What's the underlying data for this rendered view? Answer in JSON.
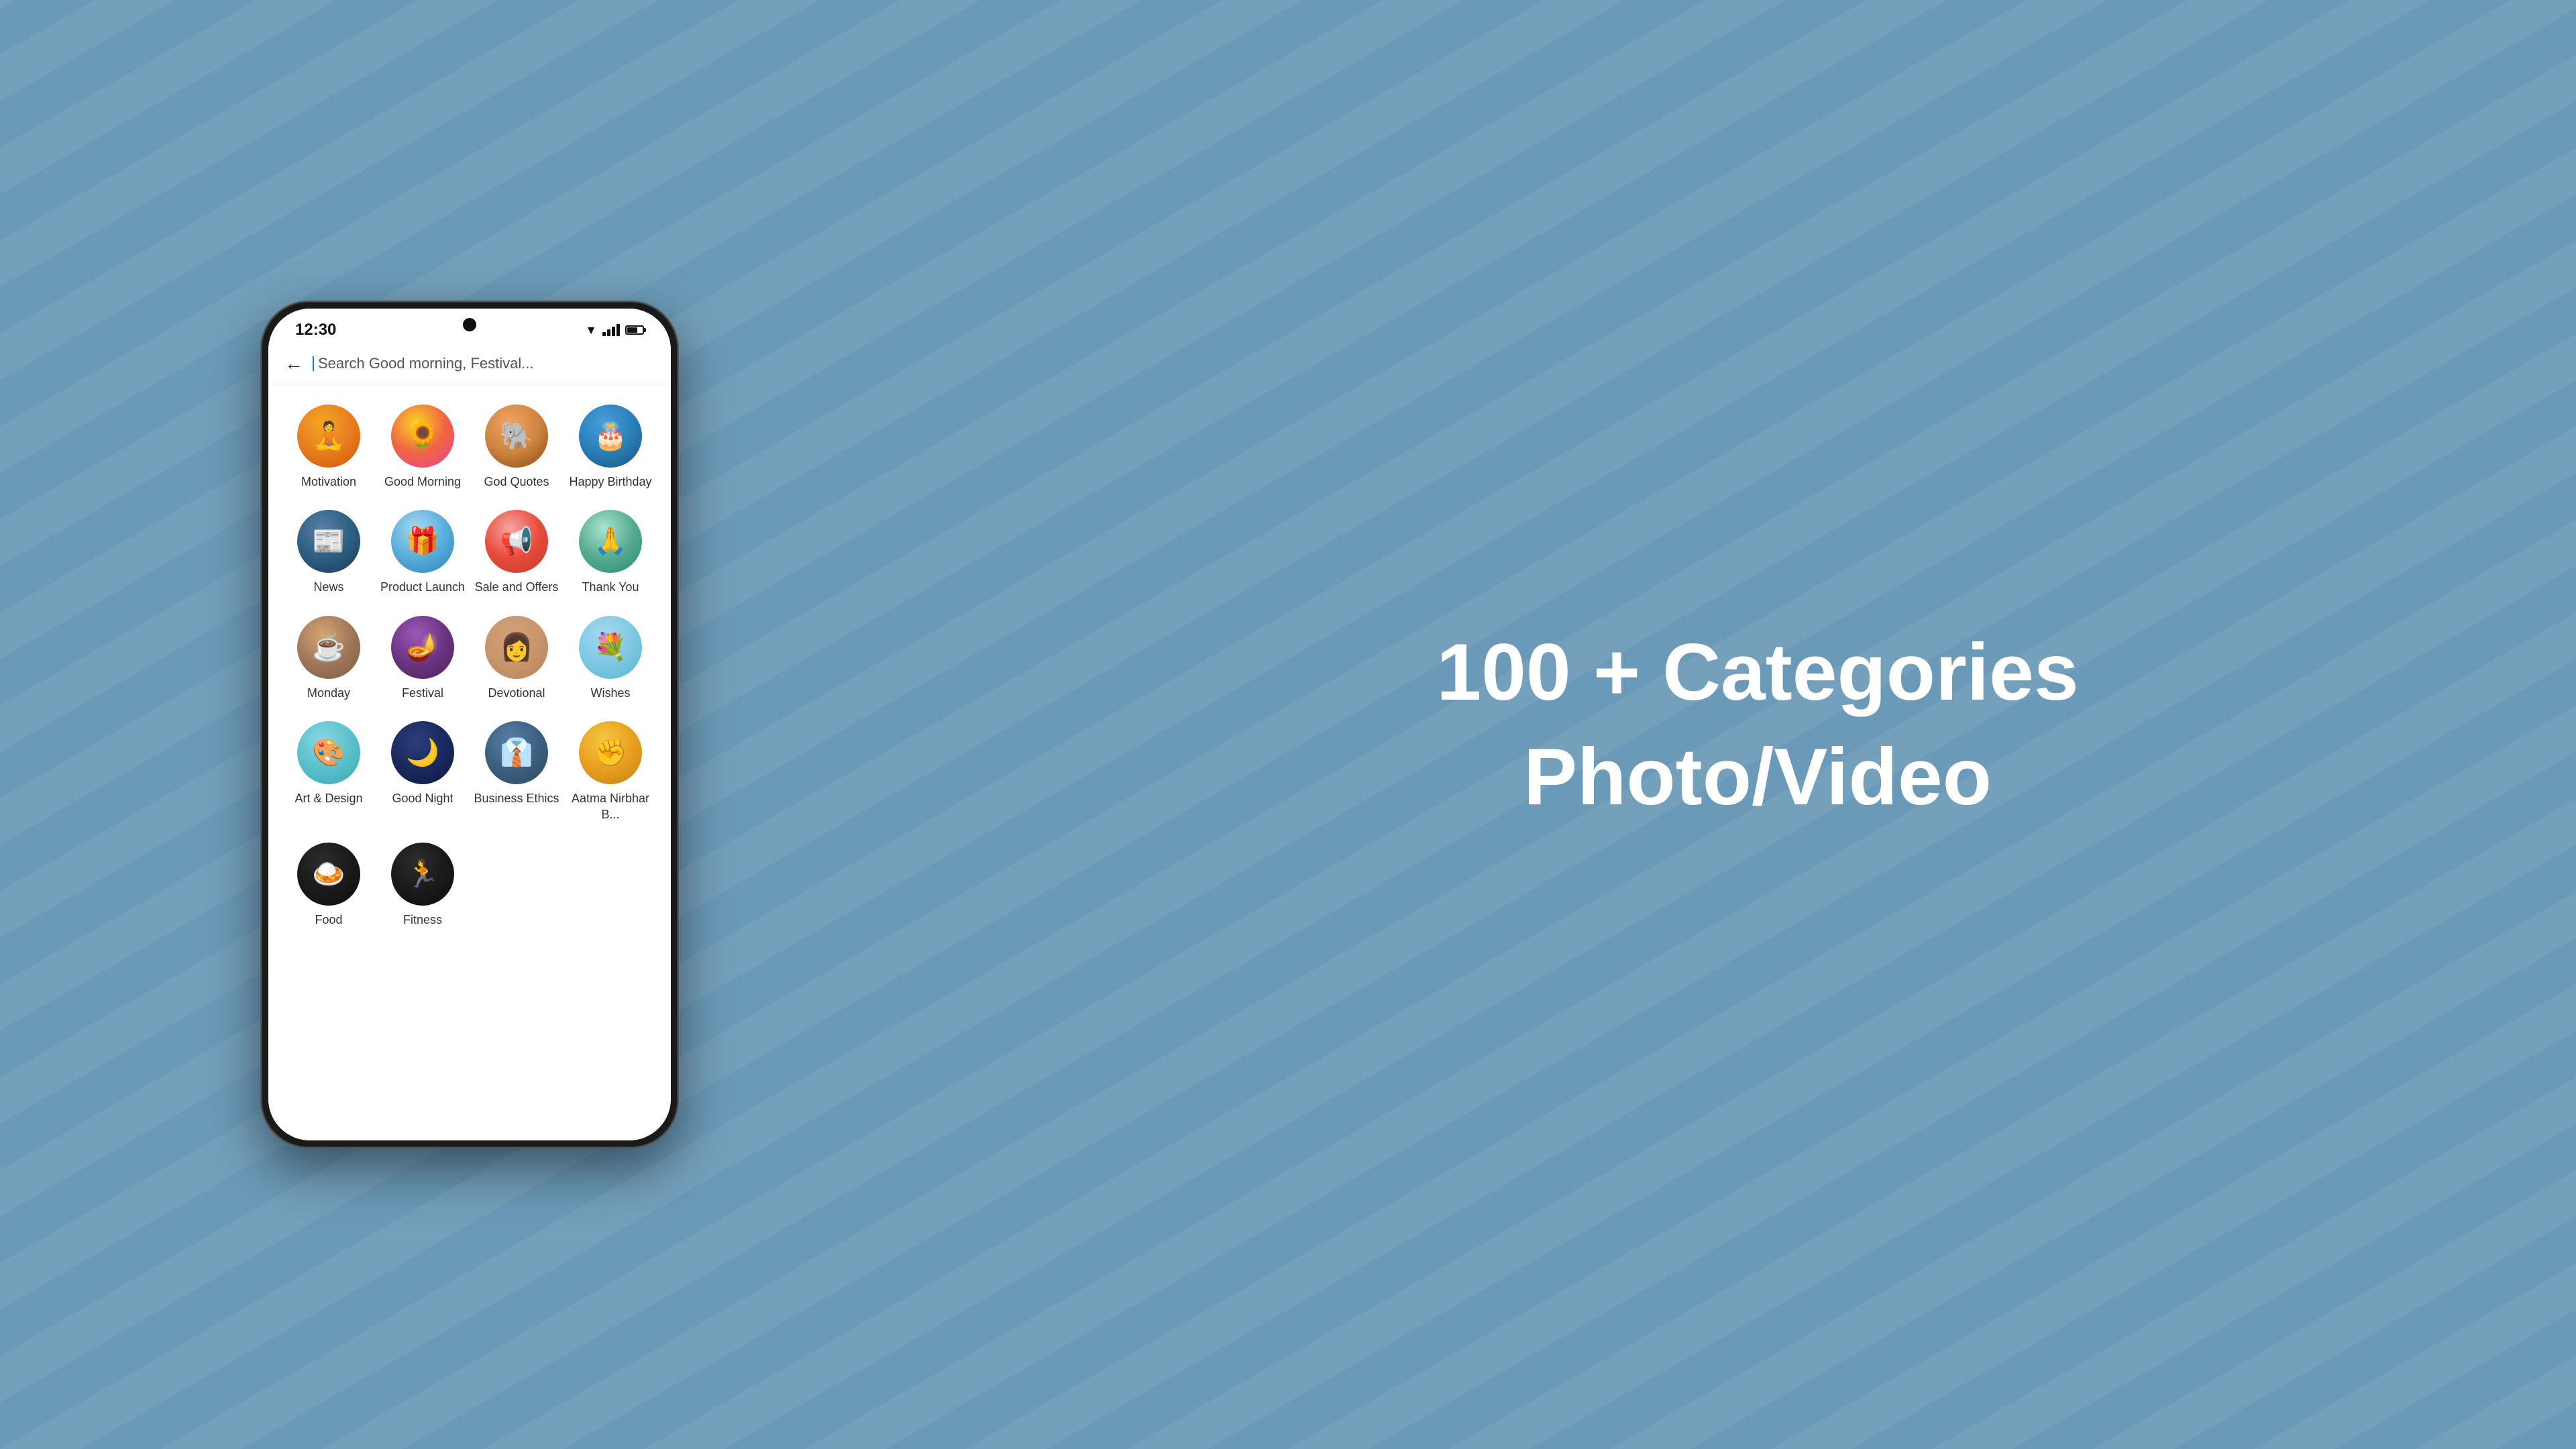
{
  "background": {
    "color": "#6b9ab8"
  },
  "status_bar": {
    "time": "12:30",
    "signal_label": "signal",
    "wifi_label": "wifi",
    "battery_label": "battery"
  },
  "search": {
    "placeholder": "Search Good morning, Festival..."
  },
  "headline": {
    "line1": "100 + Categories",
    "line2": "Photo/Video"
  },
  "categories": [
    {
      "id": "motivation",
      "label": "Motivation",
      "icon": "🧘",
      "bg_class": "cat-motivation"
    },
    {
      "id": "good-morning",
      "label": "Good Morning",
      "icon": "🌻",
      "bg_class": "cat-good-morning"
    },
    {
      "id": "god-quotes",
      "label": "God Quotes",
      "icon": "🐘",
      "bg_class": "cat-god-quotes"
    },
    {
      "id": "happy-birthday",
      "label": "Happy Birthday",
      "icon": "🎂",
      "bg_class": "cat-happy-birthday"
    },
    {
      "id": "news",
      "label": "News",
      "icon": "📰",
      "bg_class": "cat-news"
    },
    {
      "id": "product-launch",
      "label": "Product Launch",
      "icon": "🎁",
      "bg_class": "cat-product-launch"
    },
    {
      "id": "sale-offers",
      "label": "Sale and Offers",
      "icon": "📢",
      "bg_class": "cat-sale-offers"
    },
    {
      "id": "thank-you",
      "label": "Thank You",
      "icon": "🙏",
      "bg_class": "cat-thank-you"
    },
    {
      "id": "monday",
      "label": "Monday",
      "icon": "☕",
      "bg_class": "cat-monday"
    },
    {
      "id": "festival",
      "label": "Festival",
      "icon": "🪔",
      "bg_class": "cat-festival"
    },
    {
      "id": "devotional",
      "label": "Devotional",
      "icon": "👩",
      "bg_class": "cat-devotional"
    },
    {
      "id": "wishes",
      "label": "Wishes",
      "icon": "💐",
      "bg_class": "cat-wishes"
    },
    {
      "id": "art-design",
      "label": "Art & Design",
      "icon": "🎨",
      "bg_class": "cat-art-design"
    },
    {
      "id": "good-night",
      "label": "Good Night",
      "icon": "🌙",
      "bg_class": "cat-good-night"
    },
    {
      "id": "business-ethics",
      "label": "Business Ethics",
      "icon": "👔",
      "bg_class": "cat-business-ethics"
    },
    {
      "id": "aatma-nirbhar",
      "label": "Aatma Nirbhar B...",
      "icon": "✊",
      "bg_class": "cat-aatma-nirbhar"
    },
    {
      "id": "food",
      "label": "Food",
      "icon": "🍛",
      "bg_class": "cat-food"
    },
    {
      "id": "fitness",
      "label": "Fitness",
      "icon": "🏃",
      "bg_class": "cat-fitness"
    }
  ]
}
